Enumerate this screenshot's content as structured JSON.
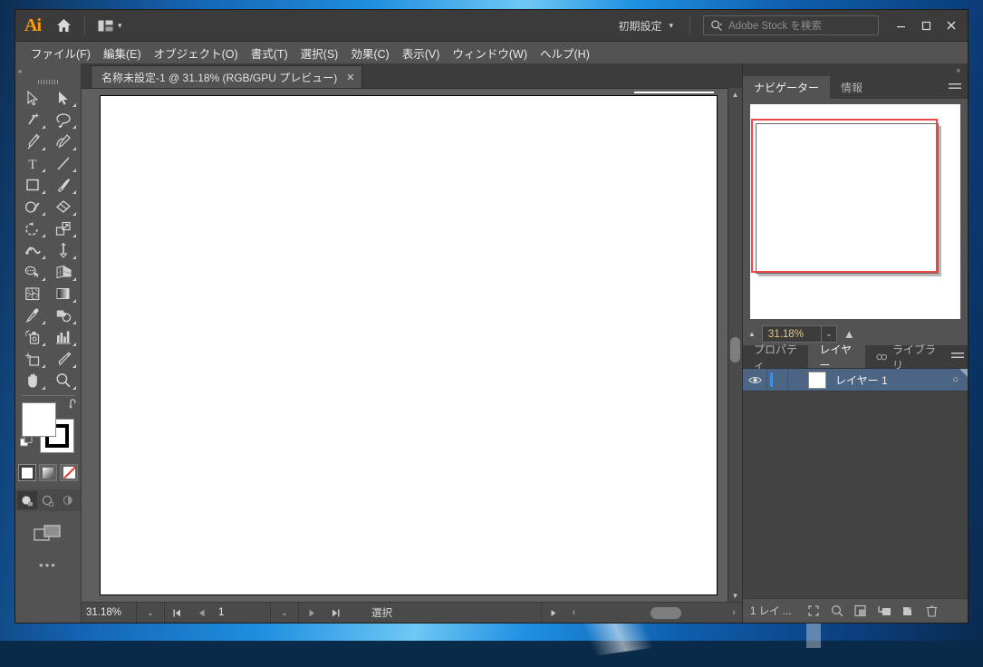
{
  "app": {
    "name": "Ai",
    "logo_color": "#ff9a00",
    "home_icon": "home-icon",
    "arrange_icon": "arrange-documents-icon",
    "workspace_label": "初期設定",
    "search_placeholder": "Adobe Stock を検索",
    "window_controls": {
      "minimize": "–",
      "maximize": "□",
      "close": "✕"
    }
  },
  "menubar": {
    "items": [
      {
        "label": "ファイル(F)"
      },
      {
        "label": "編集(E)"
      },
      {
        "label": "オブジェクト(O)"
      },
      {
        "label": "書式(T)"
      },
      {
        "label": "選択(S)"
      },
      {
        "label": "効果(C)"
      },
      {
        "label": "表示(V)"
      },
      {
        "label": "ウィンドウ(W)"
      },
      {
        "label": "ヘルプ(H)"
      }
    ]
  },
  "toolbox": {
    "collapse_label": "«",
    "tools": [
      {
        "name": "selection-tool"
      },
      {
        "name": "direct-selection-tool"
      },
      {
        "name": "magic-wand-tool"
      },
      {
        "name": "lasso-tool"
      },
      {
        "name": "pen-tool"
      },
      {
        "name": "curvature-tool"
      },
      {
        "name": "type-tool"
      },
      {
        "name": "line-segment-tool"
      },
      {
        "name": "rectangle-tool"
      },
      {
        "name": "paintbrush-tool"
      },
      {
        "name": "shaper-tool"
      },
      {
        "name": "eraser-tool"
      },
      {
        "name": "rotate-tool"
      },
      {
        "name": "scale-tool"
      },
      {
        "name": "width-tool"
      },
      {
        "name": "free-transform-tool"
      },
      {
        "name": "shape-builder-tool"
      },
      {
        "name": "perspective-grid-tool"
      },
      {
        "name": "mesh-tool"
      },
      {
        "name": "gradient-tool"
      },
      {
        "name": "eyedropper-tool"
      },
      {
        "name": "blend-tool"
      },
      {
        "name": "symbol-sprayer-tool"
      },
      {
        "name": "column-graph-tool"
      },
      {
        "name": "artboard-tool"
      },
      {
        "name": "slice-tool"
      },
      {
        "name": "hand-tool"
      },
      {
        "name": "zoom-tool"
      }
    ],
    "fill_color": "#ffffff",
    "stroke_color": "#000000",
    "swatch_buttons": [
      {
        "name": "color-swatch-button"
      },
      {
        "name": "gradient-swatch-button"
      },
      {
        "name": "none-swatch-button"
      }
    ],
    "draw_modes": [
      {
        "name": "draw-normal-mode",
        "selected": true
      },
      {
        "name": "draw-behind-mode",
        "selected": false
      },
      {
        "name": "draw-inside-mode",
        "selected": false
      }
    ],
    "screen_mode": "change-screen-mode-button",
    "more_tools": "•••"
  },
  "document": {
    "tab_title": "名称未設定-1 @ 31.18% (RGB/GPU プレビュー)",
    "tab_close": "✕"
  },
  "statusbar": {
    "zoom": "31.18%",
    "zoom_dropdown": "⌄",
    "first_page": "⏮",
    "prev_page": "◀",
    "page": "1",
    "page_dropdown": "⌄",
    "next_page": "▶",
    "last_page": "⏭",
    "status_text": "選択",
    "status_arrow": "▶",
    "scroll_left": "‹",
    "scroll_right": "›"
  },
  "navigator_dock": {
    "expand_label": "»",
    "tabs": [
      {
        "label": "ナビゲーター",
        "active": true
      },
      {
        "label": "情報",
        "active": false
      }
    ],
    "menu_icon": "panel-menu-icon",
    "view_box_color": "#f0474a",
    "zoom_value": "31.18%",
    "zoom_dropdown": "⌄",
    "zoom_out_icon": "zoom-out-small-icon",
    "zoom_in_icon": "zoom-in-large-icon"
  },
  "layers_dock": {
    "tabs": [
      {
        "label": "プロパティ",
        "active": false
      },
      {
        "label": "レイヤー",
        "active": true
      },
      {
        "label": "ライブラリ",
        "active": false,
        "icon": "cc-libraries-icon"
      }
    ],
    "menu_icon": "panel-menu-icon",
    "layers": [
      {
        "name": "レイヤー 1",
        "visible": true,
        "locked": false,
        "color": "#3f8fe0",
        "target": "○",
        "selected": true
      }
    ],
    "footer_count": "1 レイ ...",
    "footer_buttons": [
      {
        "name": "locate-object-button"
      },
      {
        "name": "make-clipping-mask-button"
      },
      {
        "name": "create-sublayer-button"
      },
      {
        "name": "create-new-layer-button"
      },
      {
        "name": "delete-layer-button"
      }
    ]
  }
}
